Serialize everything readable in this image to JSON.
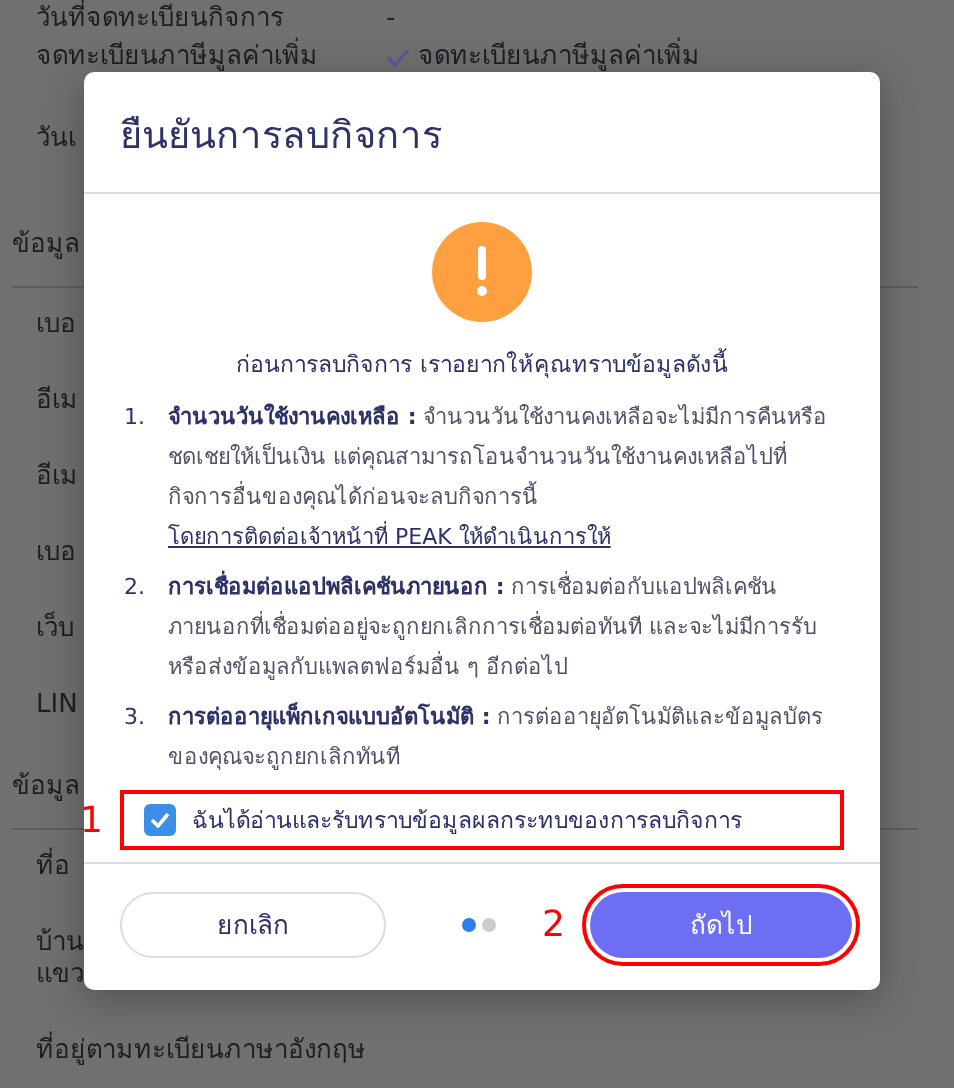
{
  "background": {
    "rows": [
      {
        "label": "วันที่จดทะเบียนกิจการ",
        "value": "-"
      },
      {
        "label": "จดทะเบียนภาษีมูลค่าเพิ่ม",
        "value": "จดทะเบียนภาษีมูลค่าเพิ่ม",
        "checked": true
      },
      {
        "label": "วันเ"
      }
    ],
    "sections": [
      {
        "title": "ข้อมูล",
        "rows": [
          "เบอ",
          "อีเม",
          "อีเม",
          "เบอ",
          "เว็บ",
          "LIN"
        ]
      },
      {
        "title": "ข้อมูล",
        "rows": [
          "ที่อ",
          "บ้าน\nแขว",
          "ที่อยู่ตามทะเบียนภาษาอังกฤษ"
        ]
      }
    ]
  },
  "dialog": {
    "title": "ยืนยันการลบกิจการ",
    "subtitle": "ก่อนการลบกิจการ เราอยากให้คุณทราบข้อมูลดังนี้",
    "items": [
      {
        "number": "1.",
        "heading": "จำนวนวันใช้งานคงเหลือ :",
        "text": "จำนวนวันใช้งานคงเหลือจะไม่มีการคืนหรือชดเชยให้เป็นเงิน แต่คุณสามารถโอนจำนวนวันใช้งานคงเหลือไปที่กิจการอื่นของคุณได้ก่อนจะลบกิจการนี้",
        "link": "โดยการติดต่อเจ้าหน้าที่ PEAK ให้ดำเนินการให้"
      },
      {
        "number": "2.",
        "heading": "การเชื่อมต่อแอปพลิเคชันภายนอก :",
        "text": "การเชื่อมต่อกับแอปพลิเคชันภายนอกที่เชื่อมต่ออยู่จะถูกยกเลิกการเชื่อมต่อทันที และจะไม่มีการรับหรือส่งข้อมูลกับแพลตฟอร์มอื่น ๆ อีกต่อไป"
      },
      {
        "number": "3.",
        "heading": "การต่ออายุแพ็กเกจแบบอัตโนมัติ :",
        "text": "การต่ออายุอัตโนมัติและข้อมูลบัตรของคุณจะถูกยกเลิกทันที"
      }
    ],
    "acknowledge": {
      "label": "ฉันได้อ่านและรับทราบข้อมูลผลกระทบของการลบกิจการ",
      "checked": true,
      "annotation": "1"
    },
    "cancel": "ยกเลิก",
    "next": {
      "label": "ถัดไป",
      "annotation": "2"
    },
    "steps": [
      {
        "selected": true
      },
      {
        "selected": false
      }
    ]
  }
}
